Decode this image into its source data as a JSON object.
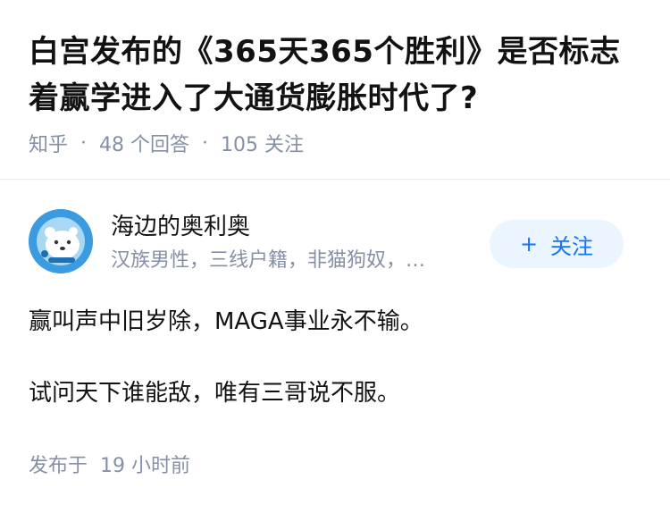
{
  "question": {
    "title": "白宫发布的《365天365个胜利》是否标志着赢学进入了大通货膨胀时代了?",
    "source": "知乎",
    "answers": "48 个回答",
    "followers": "105 关注",
    "separator": "·"
  },
  "author": {
    "name": "海边的奥利奥",
    "bio": "汉族男性，三线户籍，非猫狗奴，…",
    "avatar_icon": "avatar-polar-bear-icon",
    "follow_label": "关注",
    "follow_icon": "+"
  },
  "answer": {
    "paragraphs": [
      "赢叫声中旧岁除，MAGA事业永不输。",
      "试问天下谁能敌，唯有三哥说不服。"
    ],
    "published": "发布于  19 小时前"
  },
  "colors": {
    "text": "#121212",
    "meta": "#8590a6",
    "accent": "#1772f6",
    "follow_bg": "#ebf5ff",
    "avatar_bg": "#3b9be0"
  }
}
